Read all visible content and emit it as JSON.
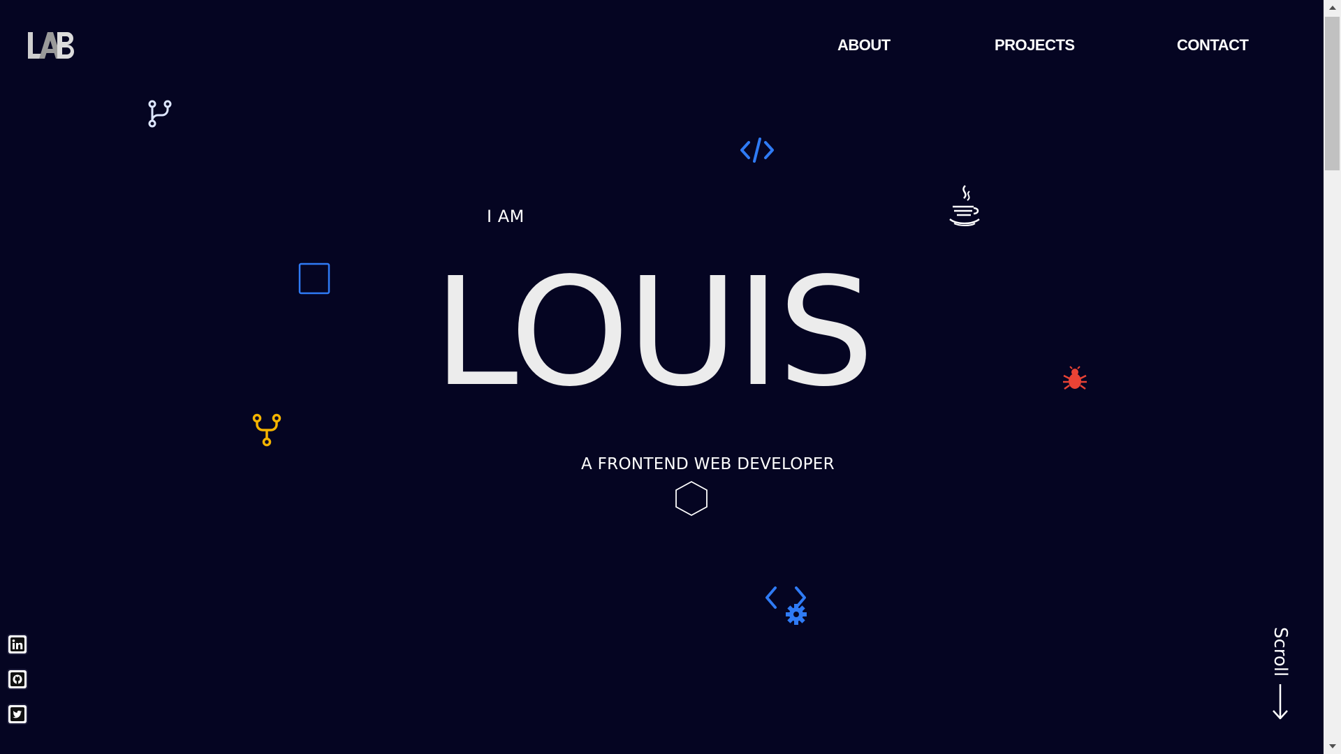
{
  "header": {
    "logo_text": "LAB",
    "nav": [
      {
        "label": "ABOUT"
      },
      {
        "label": "PROJECTS"
      },
      {
        "label": "CONTACT"
      }
    ]
  },
  "hero": {
    "intro": "I AM",
    "name": "LOUIS",
    "subtitle": "A FRONTEND WEB DEVELOPER"
  },
  "decorations": [
    {
      "icon": "git-branch-icon",
      "color": "#dde6ff"
    },
    {
      "icon": "code-tag-icon",
      "color": "#2f7bf5"
    },
    {
      "icon": "java-icon",
      "color": "#ffffff"
    },
    {
      "icon": "square-outline-icon",
      "color": "#2f7bf5"
    },
    {
      "icon": "bug-icon",
      "color": "#ea4335"
    },
    {
      "icon": "git-merge-icon",
      "color": "#f4b400"
    },
    {
      "icon": "hexagon-outline-icon",
      "color": "#ffffff"
    },
    {
      "icon": "code-gear-icon",
      "color": "#2f7bf5"
    }
  ],
  "social": [
    {
      "icon": "linkedin-icon"
    },
    {
      "icon": "github-icon"
    },
    {
      "icon": "twitter-icon"
    }
  ],
  "scroll": {
    "label": "Scroll"
  },
  "colors": {
    "background": "#050522",
    "text": "#ececec",
    "accent_blue": "#2f7bf5",
    "accent_red": "#ea4335",
    "accent_yellow": "#f4b400"
  }
}
